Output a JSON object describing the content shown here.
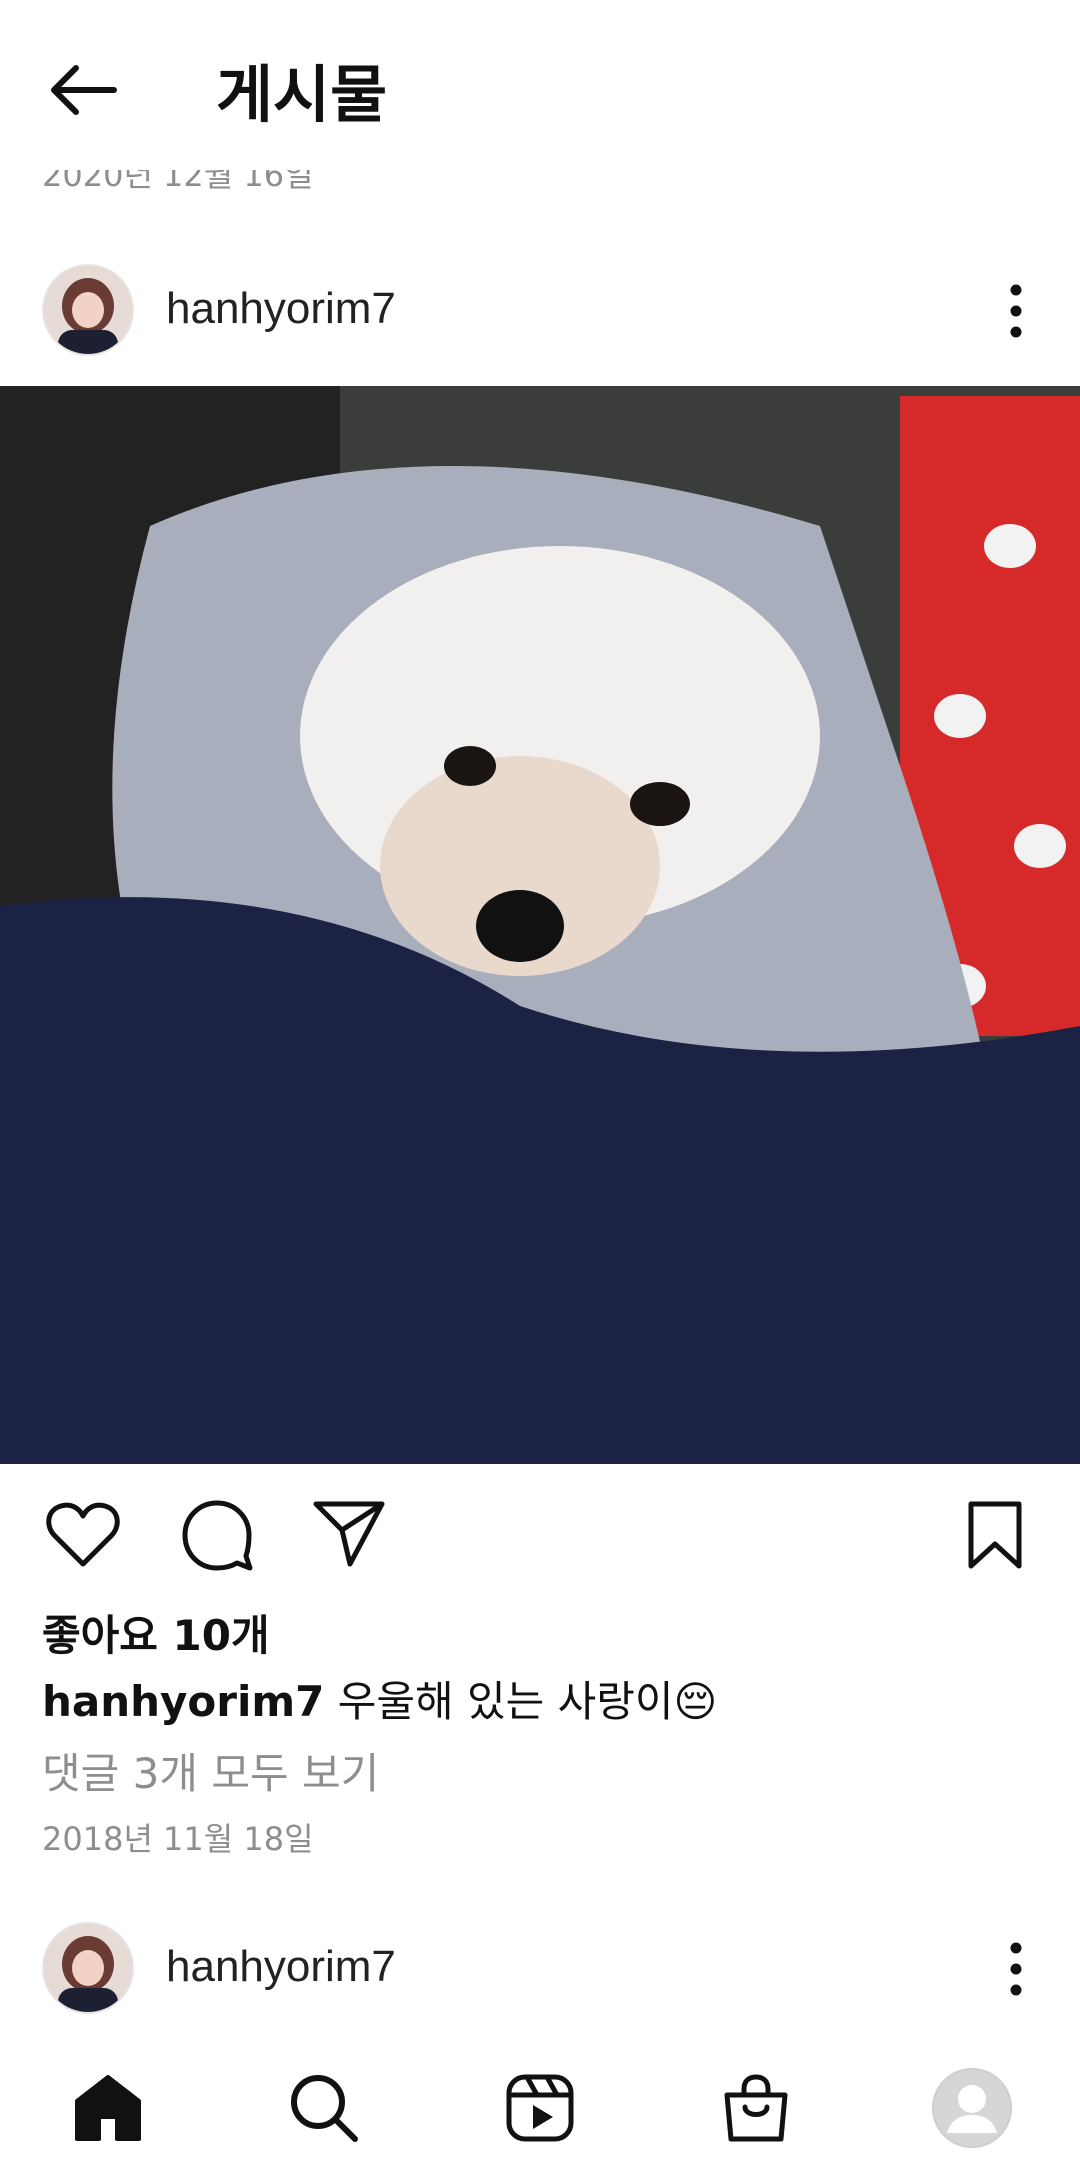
{
  "header": {
    "title": "게시물"
  },
  "previous_post": {
    "date": "2020년 12월 16일"
  },
  "post": {
    "username": "hanhyorim7",
    "likes": "좋아요 10개",
    "caption_user": "hanhyorim7",
    "caption_text": "우울해 있는 사랑이😔",
    "comments_link": "댓글 3개 모두 보기",
    "date": "2018년 11월 18일"
  },
  "next_post": {
    "username": "hanhyorim7"
  },
  "icons": {
    "back": "arrow-left-icon",
    "more": "more-vertical-icon",
    "like": "heart-icon",
    "comment": "comment-icon",
    "share": "send-icon",
    "save": "bookmark-icon",
    "home": "home-icon",
    "search": "search-icon",
    "reels": "reels-icon",
    "shop": "shop-icon",
    "profile": "profile-icon"
  }
}
